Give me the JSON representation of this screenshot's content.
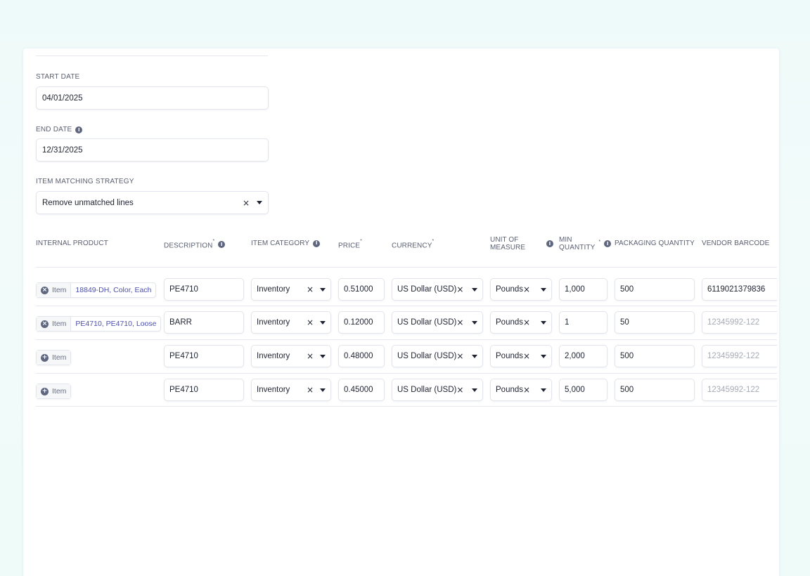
{
  "form": {
    "start_date_label": "START DATE",
    "start_date_value": "04/01/2025",
    "end_date_label": "END DATE",
    "end_date_value": "12/31/2025",
    "strategy_label": "ITEM MATCHING STRATEGY",
    "strategy_value": "Remove unmatched lines"
  },
  "table": {
    "headers": {
      "internal_product": "INTERNAL PRODUCT",
      "description": "DESCRIPTION",
      "item_category": "ITEM CATEGORY",
      "price": "PRICE",
      "currency": "CURRENCY",
      "unit_line1": "UNIT OF",
      "unit_line2": "MEASURE",
      "minqty_line1": "MIN",
      "minqty_line2": "QUANTITY",
      "packaging_quantity": "PACKAGING QUANTITY",
      "vendor_barcode": "VENDOR BARCODE",
      "required_mark": "*"
    },
    "item_label": "Item",
    "rows": [
      {
        "product": "18849-DH, Color, Each",
        "description": "PE4710",
        "category": "Inventory",
        "price": "0.51000",
        "currency": "US Dollar (USD)",
        "unit": "Pounds",
        "min_qty": "1,000",
        "packaging": "500",
        "barcode": "6119021379836",
        "barcode_placeholder": false
      },
      {
        "product": "PE4710, PE4710, Loose",
        "description": "BARR",
        "category": "Inventory",
        "price": "0.12000",
        "currency": "US Dollar (USD)",
        "unit": "Pounds",
        "min_qty": "1",
        "packaging": "50",
        "barcode": "12345992-122",
        "barcode_placeholder": true
      },
      {
        "product": "",
        "description": "PE4710",
        "category": "Inventory",
        "price": "0.48000",
        "currency": "US Dollar (USD)",
        "unit": "Pounds",
        "min_qty": "2,000",
        "packaging": "500",
        "barcode": "12345992-122",
        "barcode_placeholder": true
      },
      {
        "product": "",
        "description": "PE4710",
        "category": "Inventory",
        "price": "0.45000",
        "currency": "US Dollar (USD)",
        "unit": "Pounds",
        "min_qty": "5,000",
        "packaging": "500",
        "barcode": "12345992-122",
        "barcode_placeholder": true
      }
    ]
  },
  "icons": {
    "clear": "×",
    "info": "i",
    "remove_item": "×",
    "add_item": "+"
  }
}
